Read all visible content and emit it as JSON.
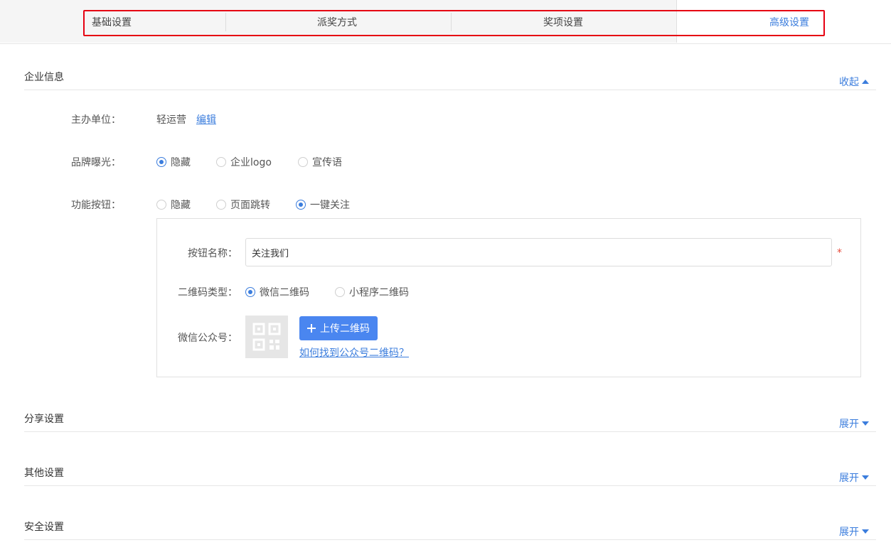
{
  "tabs": [
    {
      "label": "基础设置"
    },
    {
      "label": "派奖方式"
    },
    {
      "label": "奖项设置"
    },
    {
      "label": "高级设置"
    }
  ],
  "sections": {
    "company": {
      "title": "企业信息",
      "toggle": "收起"
    },
    "share": {
      "title": "分享设置",
      "toggle": "展开"
    },
    "other": {
      "title": "其他设置",
      "toggle": "展开"
    },
    "security": {
      "title": "安全设置",
      "toggle": "展开"
    }
  },
  "company": {
    "organizer_label": "主办单位：",
    "organizer_value": "轻运营",
    "organizer_edit": "编辑",
    "brand_label": "品牌曝光：",
    "brand_options": [
      {
        "label": "隐藏",
        "checked": true
      },
      {
        "label": "企业logo",
        "checked": false
      },
      {
        "label": "宣传语",
        "checked": false
      }
    ],
    "func_label": "功能按钮：",
    "func_options": [
      {
        "label": "隐藏",
        "checked": false
      },
      {
        "label": "页面跳转",
        "checked": false
      },
      {
        "label": "一键关注",
        "checked": true
      }
    ],
    "button_name_label": "按钮名称：",
    "button_name_value": "关注我们",
    "required_mark": "*",
    "qr_type_label": "二维码类型：",
    "qr_type_options": [
      {
        "label": "微信二维码",
        "checked": true
      },
      {
        "label": "小程序二维码",
        "checked": false
      }
    ],
    "wechat_label": "微信公众号：",
    "upload_button": "上传二维码",
    "help_link": "如何找到公众号二维码？"
  },
  "colors": {
    "accent": "#3b7ddd",
    "button": "#4a86f0",
    "highlight": "#e60012"
  }
}
